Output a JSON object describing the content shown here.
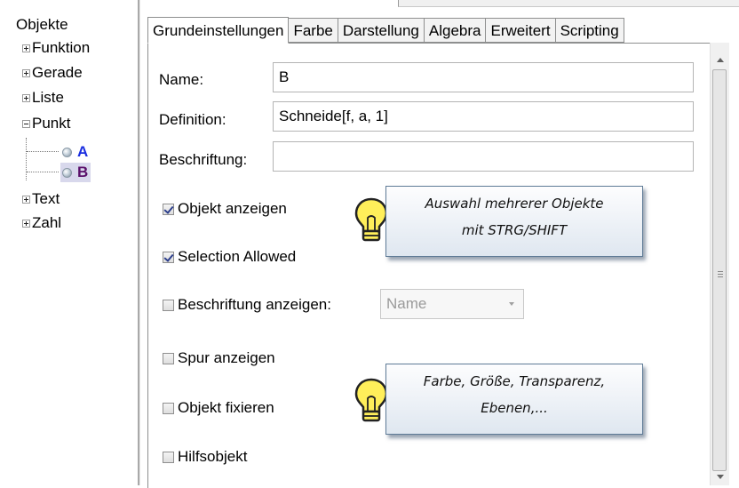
{
  "tree": {
    "root_label": "Objekte",
    "items": [
      {
        "label": "Funktion",
        "expanded": false
      },
      {
        "label": "Gerade",
        "expanded": false
      },
      {
        "label": "Liste",
        "expanded": false
      },
      {
        "label": "Punkt",
        "expanded": true
      },
      {
        "label": "Text",
        "expanded": false
      },
      {
        "label": "Zahl",
        "expanded": false
      }
    ],
    "points": [
      {
        "label": "A",
        "color": "#1a2ee0",
        "selected": false
      },
      {
        "label": "B",
        "color": "#5a0f6a",
        "selected": true
      }
    ]
  },
  "tabs": [
    {
      "label": "Grundeinstellungen",
      "active": true
    },
    {
      "label": "Farbe",
      "active": false
    },
    {
      "label": "Darstellung",
      "active": false
    },
    {
      "label": "Algebra",
      "active": false
    },
    {
      "label": "Erweitert",
      "active": false
    },
    {
      "label": "Scripting",
      "active": false
    }
  ],
  "form": {
    "name_label": "Name:",
    "name_value": "B",
    "definition_label": "Definition:",
    "definition_value": "Schneide[f, a, 1]",
    "caption_label": "Beschriftung:",
    "caption_value": "",
    "show_object_label": "Objekt anzeigen",
    "show_object_checked": true,
    "selection_allowed_label": "Selection Allowed",
    "selection_allowed_checked": true,
    "show_label_label": "Beschriftung anzeigen:",
    "show_label_checked": false,
    "show_label_option": "Name",
    "trace_label": "Spur anzeigen",
    "trace_checked": false,
    "fix_object_label": "Objekt fixieren",
    "fix_object_checked": false,
    "auxiliary_label": "Hilfsobjekt",
    "auxiliary_checked": false
  },
  "callouts": {
    "first_line1": "Auswahl mehrerer Objekte",
    "first_line2": "mit STRG/SHIFT",
    "second_line1": "Farbe, Größe, Transparenz,",
    "second_line2": "Ebenen,..."
  },
  "colors": {
    "bulb_fill": "#ffef5a",
    "callout_border": "#5f7b96",
    "selected_bg": "#d8d8ec"
  }
}
